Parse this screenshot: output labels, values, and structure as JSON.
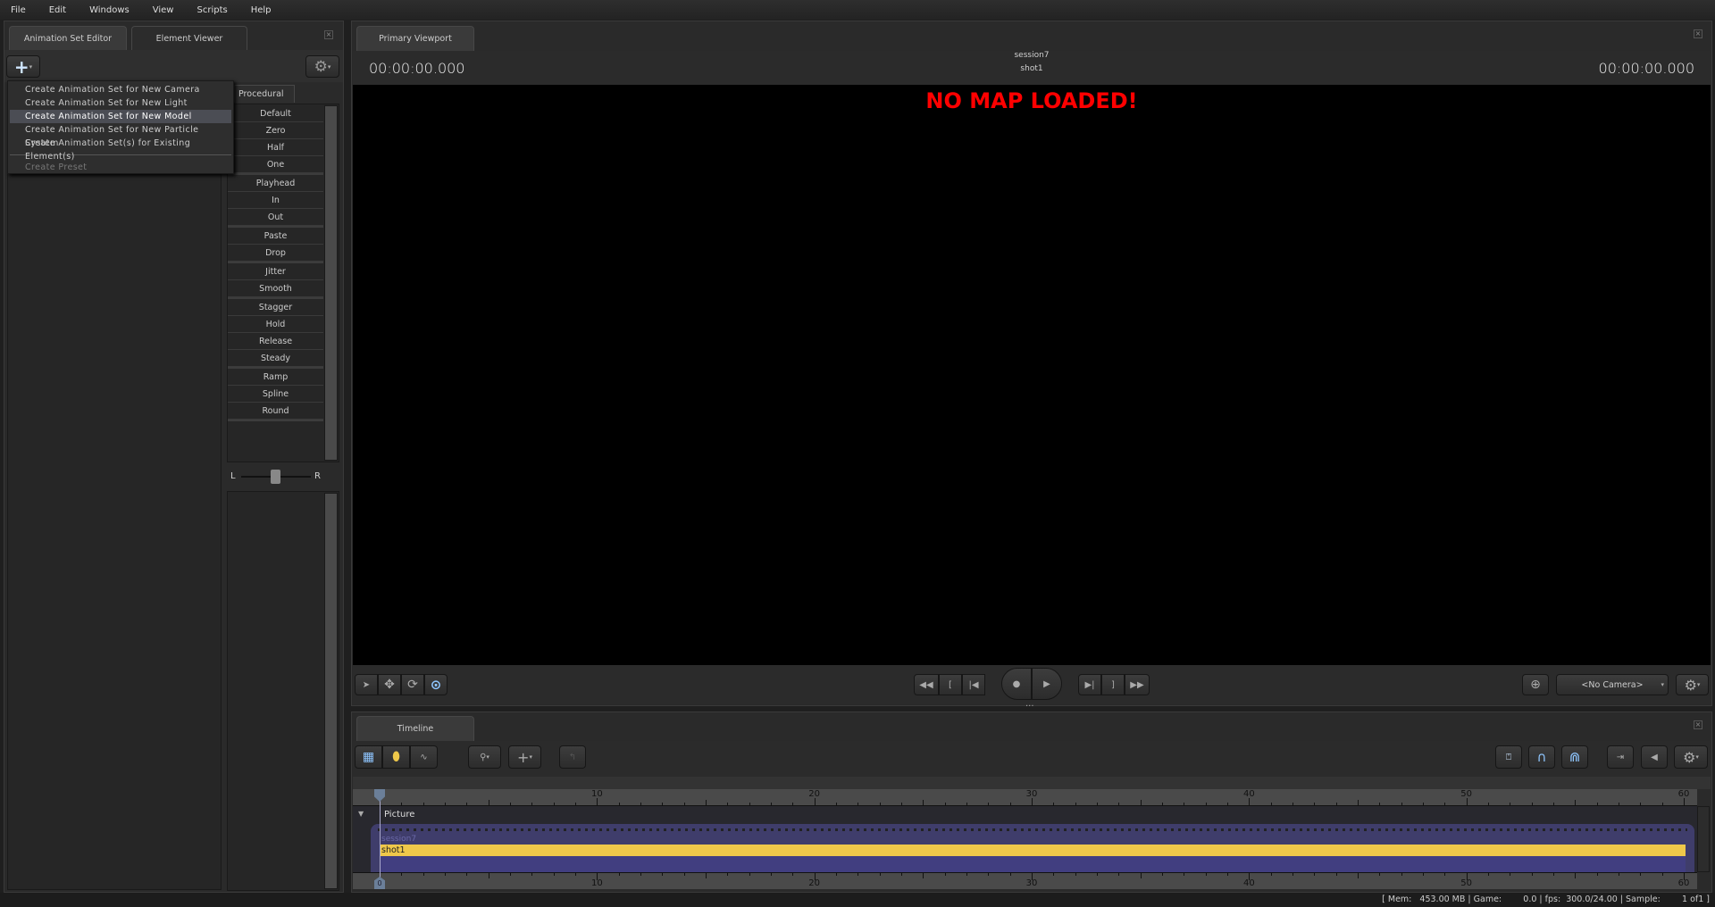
{
  "menu": [
    "File",
    "Edit",
    "Windows",
    "View",
    "Scripts",
    "Help"
  ],
  "left_panel": {
    "tabs": [
      "Animation Set Editor",
      "Element Viewer"
    ],
    "dropdown": {
      "items": [
        "Create Animation Set for New Camera",
        "Create Animation Set for New Light",
        "Create Animation Set for New Model",
        "Create Animation Set for New Particle System",
        "Create Animation Set(s) for Existing Element(s)"
      ],
      "highlighted": 2,
      "disabled_item": "Create Preset"
    },
    "procedural_tab": "Procedural",
    "procedural_groups": [
      [
        "Default",
        "Zero",
        "Half",
        "One"
      ],
      [
        "Playhead",
        "In",
        "Out"
      ],
      [
        "Paste",
        "Drop"
      ],
      [
        "Jitter",
        "Smooth"
      ],
      [
        "Stagger",
        "Hold",
        "Release",
        "Steady"
      ],
      [
        "Ramp",
        "Spline",
        "Round"
      ]
    ],
    "slider": {
      "left": "L",
      "right": "R",
      "value": 0.5
    }
  },
  "viewport": {
    "tab": "Primary Viewport",
    "session": "session7",
    "shot": "shot1",
    "timecode_left": "00:00:00.000",
    "timecode_right": "00:00:00.000",
    "message": "NO MAP LOADED!",
    "camera": "<No Camera>"
  },
  "timeline": {
    "tab": "Timeline",
    "track_header": "Picture",
    "session_label": "session7",
    "clip_label": "shot1",
    "ruler_labels": [
      "10",
      "20",
      "30",
      "40",
      "50",
      "60"
    ],
    "range": [
      0,
      60
    ],
    "playhead": 0,
    "playhead_label": "0"
  },
  "status": {
    "text": "[ Mem:   453.00 MB | Game:        0.0 | fps:  300.0/24.00 | Sample:        1 of1 ]"
  },
  "colors": {
    "clip": "#efc84a",
    "session": "#3e3b74",
    "message": "#ff0000",
    "accent": "#8fc6ff"
  }
}
